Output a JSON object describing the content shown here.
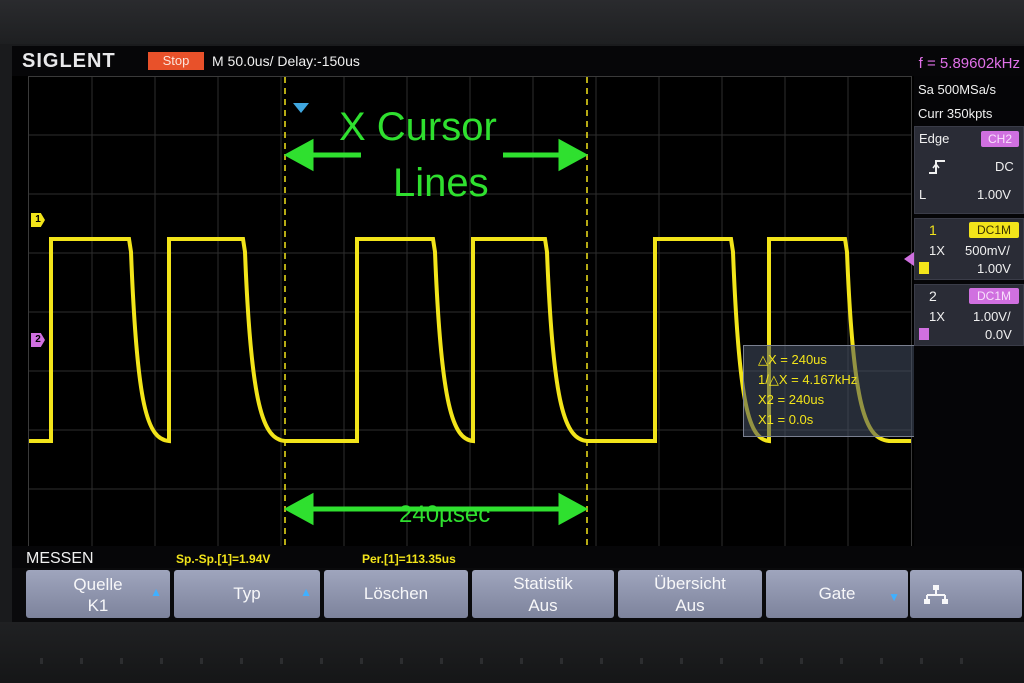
{
  "header": {
    "brand": "SIGLENT",
    "run_state": "Stop",
    "timebase": "M 50.0us/",
    "delay": "Delay:-150us",
    "frequency": "f = 5.89602kHz"
  },
  "acquisition": {
    "sample_rate": "Sa 500MSa/s",
    "memory": "Curr 350kpts"
  },
  "trigger": {
    "type": "Edge",
    "source": "CH2",
    "coupling": "DC",
    "level_label": "L",
    "level": "1.00V"
  },
  "channels": [
    {
      "num": "1",
      "coupling": "DC1M",
      "probe": "1X",
      "scale": "500mV/",
      "offset": "1.00V",
      "color": "#f2e41a"
    },
    {
      "num": "2",
      "coupling": "DC1M",
      "probe": "1X",
      "scale": "1.00V/",
      "offset": "0.0V",
      "color": "#d070e0"
    }
  ],
  "annotations": {
    "title": "X Cursor",
    "lines": "Lines",
    "delta": "240µsec"
  },
  "cursor_readout": {
    "dx": "△X = 240us",
    "inv_dx": "1/△X = 4.167kHz",
    "x2": "X2 = 240us",
    "x1": "X1 = 0.0s"
  },
  "measure": {
    "label": "MESSEN",
    "items": [
      "Sp.-Sp.[1]=1.94V",
      "Per.[1]=113.35us"
    ]
  },
  "softkeys": [
    {
      "line1": "Quelle",
      "line2": "K1",
      "arrow": "up"
    },
    {
      "line1": "Typ",
      "line2": "",
      "arrow": "up"
    },
    {
      "line1": "Löschen",
      "line2": "",
      "arrow": ""
    },
    {
      "line1": "Statistik",
      "line2": "Aus",
      "arrow": ""
    },
    {
      "line1": "Übersicht",
      "line2": "Aus",
      "arrow": ""
    },
    {
      "line1": "Gate",
      "line2": "",
      "arrow": "down"
    }
  ],
  "markers": {
    "ch1": "1",
    "ch2": "2"
  },
  "icons": {
    "network": "network-icon",
    "trigger_slope": "rising-edge-icon"
  }
}
